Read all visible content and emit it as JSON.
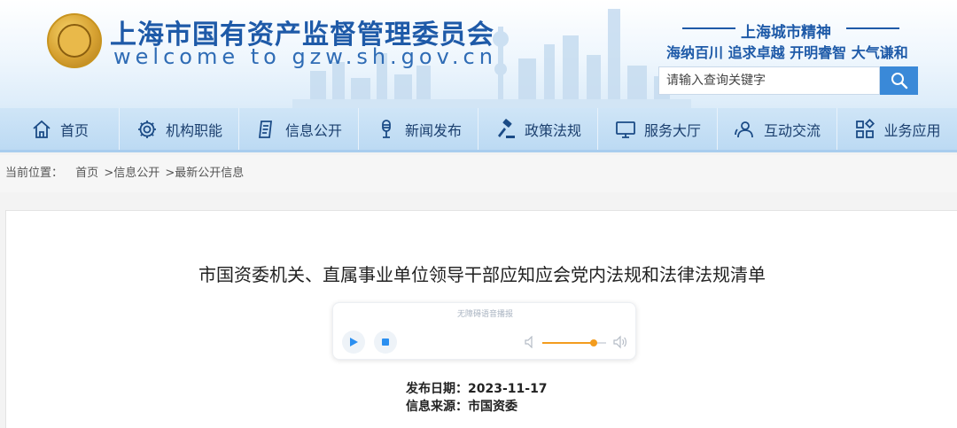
{
  "header": {
    "title": "上海市国有资产监督管理委员会",
    "subtitle": "welcome to gzw.sh.gov.cn",
    "spirit_title": "上海城市精神",
    "spirit_text": "海纳百川 追求卓越 开明睿智 大气谦和",
    "search_placeholder": "请输入查询关键字"
  },
  "nav": {
    "items": [
      {
        "label": "首页",
        "icon": "home-icon"
      },
      {
        "label": "机构职能",
        "icon": "gear-icon"
      },
      {
        "label": "信息公开",
        "icon": "document-icon"
      },
      {
        "label": "新闻发布",
        "icon": "microphone-icon"
      },
      {
        "label": "政策法规",
        "icon": "gavel-icon"
      },
      {
        "label": "服务大厅",
        "icon": "monitor-icon"
      },
      {
        "label": "互动交流",
        "icon": "users-icon"
      },
      {
        "label": "业务应用",
        "icon": "apps-icon"
      }
    ]
  },
  "breadcrumb": {
    "prefix": "当前位置：",
    "items": [
      "首页",
      ">信息公开",
      ">最新公开信息"
    ]
  },
  "article": {
    "title": "市国资委机关、直属事业单位领导干部应知应会党内法规和法律法规清单",
    "player_label": "无障碍语音播报",
    "volume": 0.8,
    "date_label": "发布日期：",
    "date_value": "2023-11-17",
    "source_label": "信息来源：",
    "source_value": "市国资委"
  },
  "colors": {
    "brand_blue": "#1e5aa8",
    "nav_bg": "#c5e0f5",
    "search_button": "#3a89d8",
    "volume_accent": "#f39c1e"
  }
}
